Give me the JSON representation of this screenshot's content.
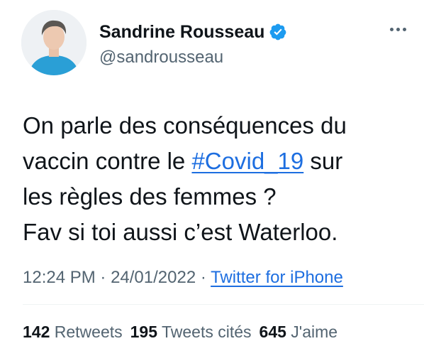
{
  "author": {
    "display_name": "Sandrine Rousseau",
    "handle": "@sandrousseau",
    "verified": true,
    "avatar_icon": "profile-photo"
  },
  "tweet": {
    "lines": [
      "On parle des conséquences du",
      "vaccin contre le ",
      "les règles des femmes ?",
      "Fav si toi aussi c’est Waterloo."
    ],
    "hashtag": "#Covid_19",
    "after_hashtag": " sur"
  },
  "meta": {
    "time": "12:24 PM",
    "separator1": " · ",
    "date": "24/01/2022",
    "separator2": " · ",
    "source": "Twitter for iPhone"
  },
  "stats": {
    "retweets_count": "142",
    "retweets_label": " Retweets",
    "quotes_count": "195",
    "quotes_label": " Tweets cités",
    "likes_count": "645",
    "likes_label": " J'aime"
  },
  "colors": {
    "link": "#1d6ee0",
    "verified_badge": "#1d9bf0",
    "secondary_text": "#536471",
    "primary_text": "#0f1419"
  }
}
